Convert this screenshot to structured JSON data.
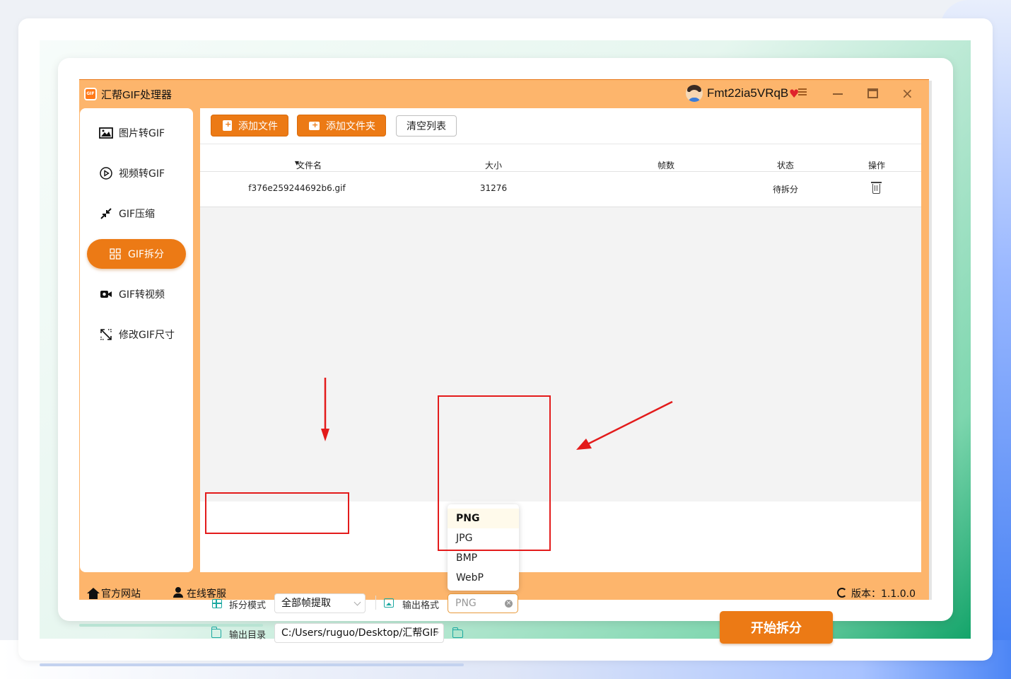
{
  "app": {
    "title": "汇帮GIF处理器",
    "logo_text": "GIF",
    "user_name": "Fmt22ia5VRqB",
    "version_label": "版本：1.1.0.0"
  },
  "sidebar": {
    "items": [
      {
        "label": "图片转GIF",
        "icon": "image-icon",
        "active": false
      },
      {
        "label": "视频转GIF",
        "icon": "play-circle-icon",
        "active": false
      },
      {
        "label": "GIF压缩",
        "icon": "compress-icon",
        "active": false
      },
      {
        "label": "GIF拆分",
        "icon": "grid-icon",
        "active": true
      },
      {
        "label": "GIF转视频",
        "icon": "video-camera-icon",
        "active": false
      },
      {
        "label": "修改GIF尺寸",
        "icon": "resize-icon",
        "active": false
      }
    ]
  },
  "toolbar": {
    "add_file": "添加文件",
    "add_folder": "添加文件夹",
    "clear_list": "清空列表"
  },
  "table": {
    "columns": [
      "文件名",
      "大小",
      "帧数",
      "状态",
      "操作"
    ],
    "rows": [
      {
        "filename": "f376e259244692b6.gif",
        "size": "31276",
        "frames": "",
        "status": "待拆分"
      }
    ]
  },
  "options": {
    "split_mode_label": "拆分模式",
    "split_mode_value": "全部帧提取",
    "output_format_label": "输出格式",
    "output_format_value": "PNG",
    "output_dir_label": "输出目录",
    "output_dir_value": "C:/Users/ruguo/Desktop/汇帮GIF"
  },
  "format_dropdown": {
    "options": [
      "PNG",
      "JPG",
      "BMP",
      "WebP"
    ],
    "selected": "PNG"
  },
  "start_button": "开始拆分",
  "footer": {
    "website": "官方网站",
    "support": "在线客服"
  },
  "colors": {
    "accent": "#ec7a15",
    "app_bg": "#fdb56c",
    "annotation": "#e31b1b",
    "teal_icon": "#1aa8a0"
  }
}
